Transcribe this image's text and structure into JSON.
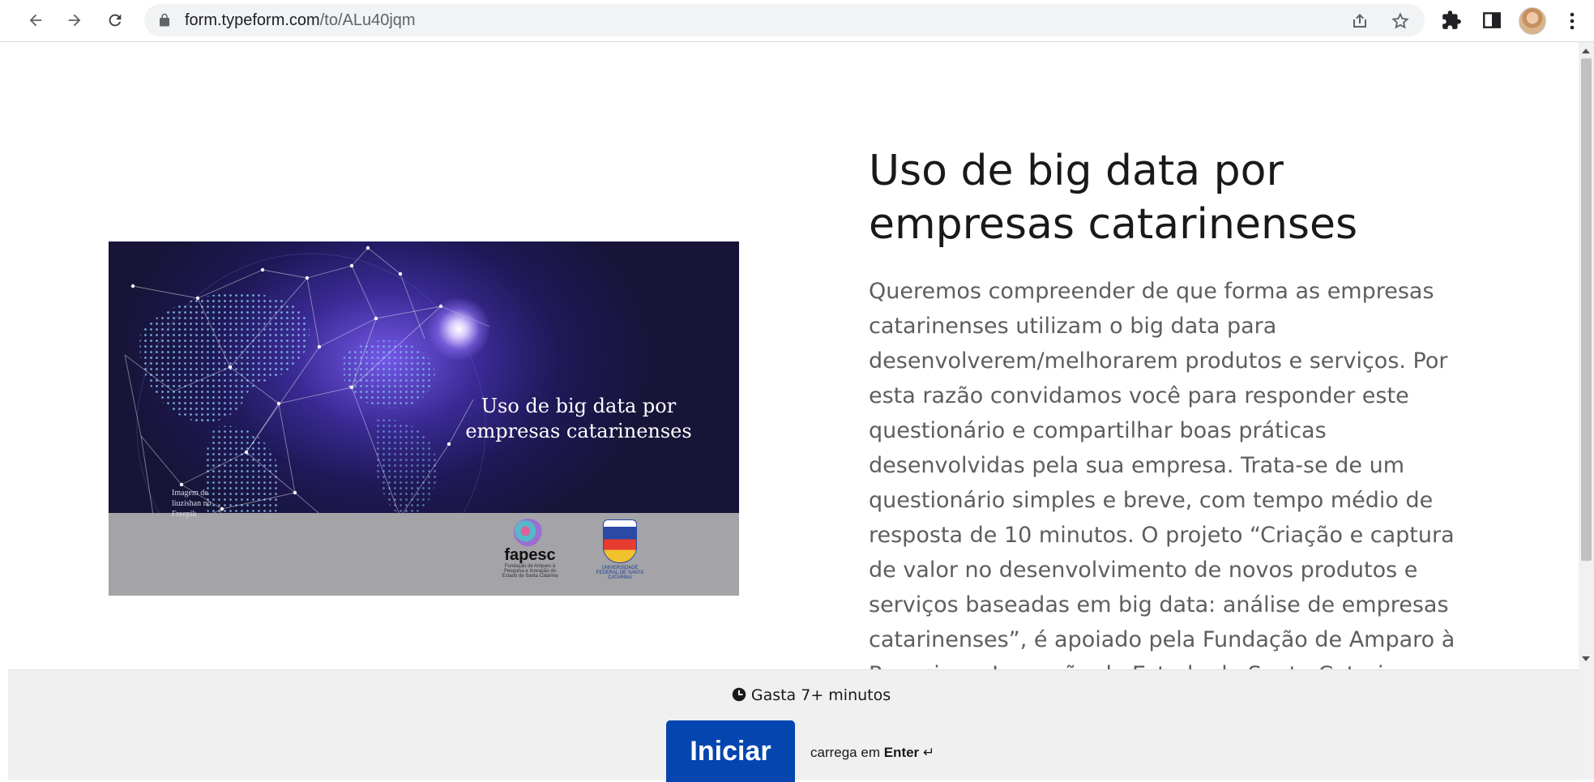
{
  "browser": {
    "url_domain": "form.typeform.com",
    "url_path": "/to/ALu40jqm",
    "icons": {
      "back": "arrow-left-icon",
      "forward": "arrow-right-icon",
      "reload": "reload-icon",
      "lock": "lock-icon",
      "share": "share-icon",
      "bookmark": "star-icon",
      "extensions": "puzzle-icon",
      "side_panel": "side-panel-icon",
      "menu": "more-vert-icon"
    }
  },
  "hero": {
    "title": "Uso de big data por empresas catarinenses",
    "credit": "Imagem de liuzishan no Freepik",
    "fapesc_name": "fapesc",
    "fapesc_sub": "Fundação de Amparo à Pesquisa e Inovação do Estado de Santa Catarina",
    "ufsc_sub": "UNIVERSIDADE FEDERAL DE SANTA CATARINA"
  },
  "form": {
    "title": "Uso de big data por empresas catarinenses",
    "description": "Queremos compreender de que forma as empresas catarinenses utilizam o big data para desenvolverem/melhorarem produtos e serviços. Por esta razão convidamos você para responder este questionário e compartilhar boas práticas desenvolvidas pela sua empresa. Trata-se de um questionário simples e breve, com tempo médio de resposta de 10 minutos. O projeto “Criação e captura de valor no desenvolvimento de novos produtos e serviços baseadas em big data: análise de empresas catarinenses”, é apoiado pela Fundação de Amparo à Pesquisa e Inovação do Estado de Santa Catarina"
  },
  "footer": {
    "time_label": "Gasta 7+ minutos",
    "start_label": "Iniciar",
    "hint_prefix": "carrega em",
    "hint_key": "Enter",
    "hint_symbol": "↵"
  },
  "colors": {
    "button": "#0445af",
    "title_text": "#191919",
    "body_text": "#5e5e5e",
    "footer_bg": "#f0f0f0"
  }
}
